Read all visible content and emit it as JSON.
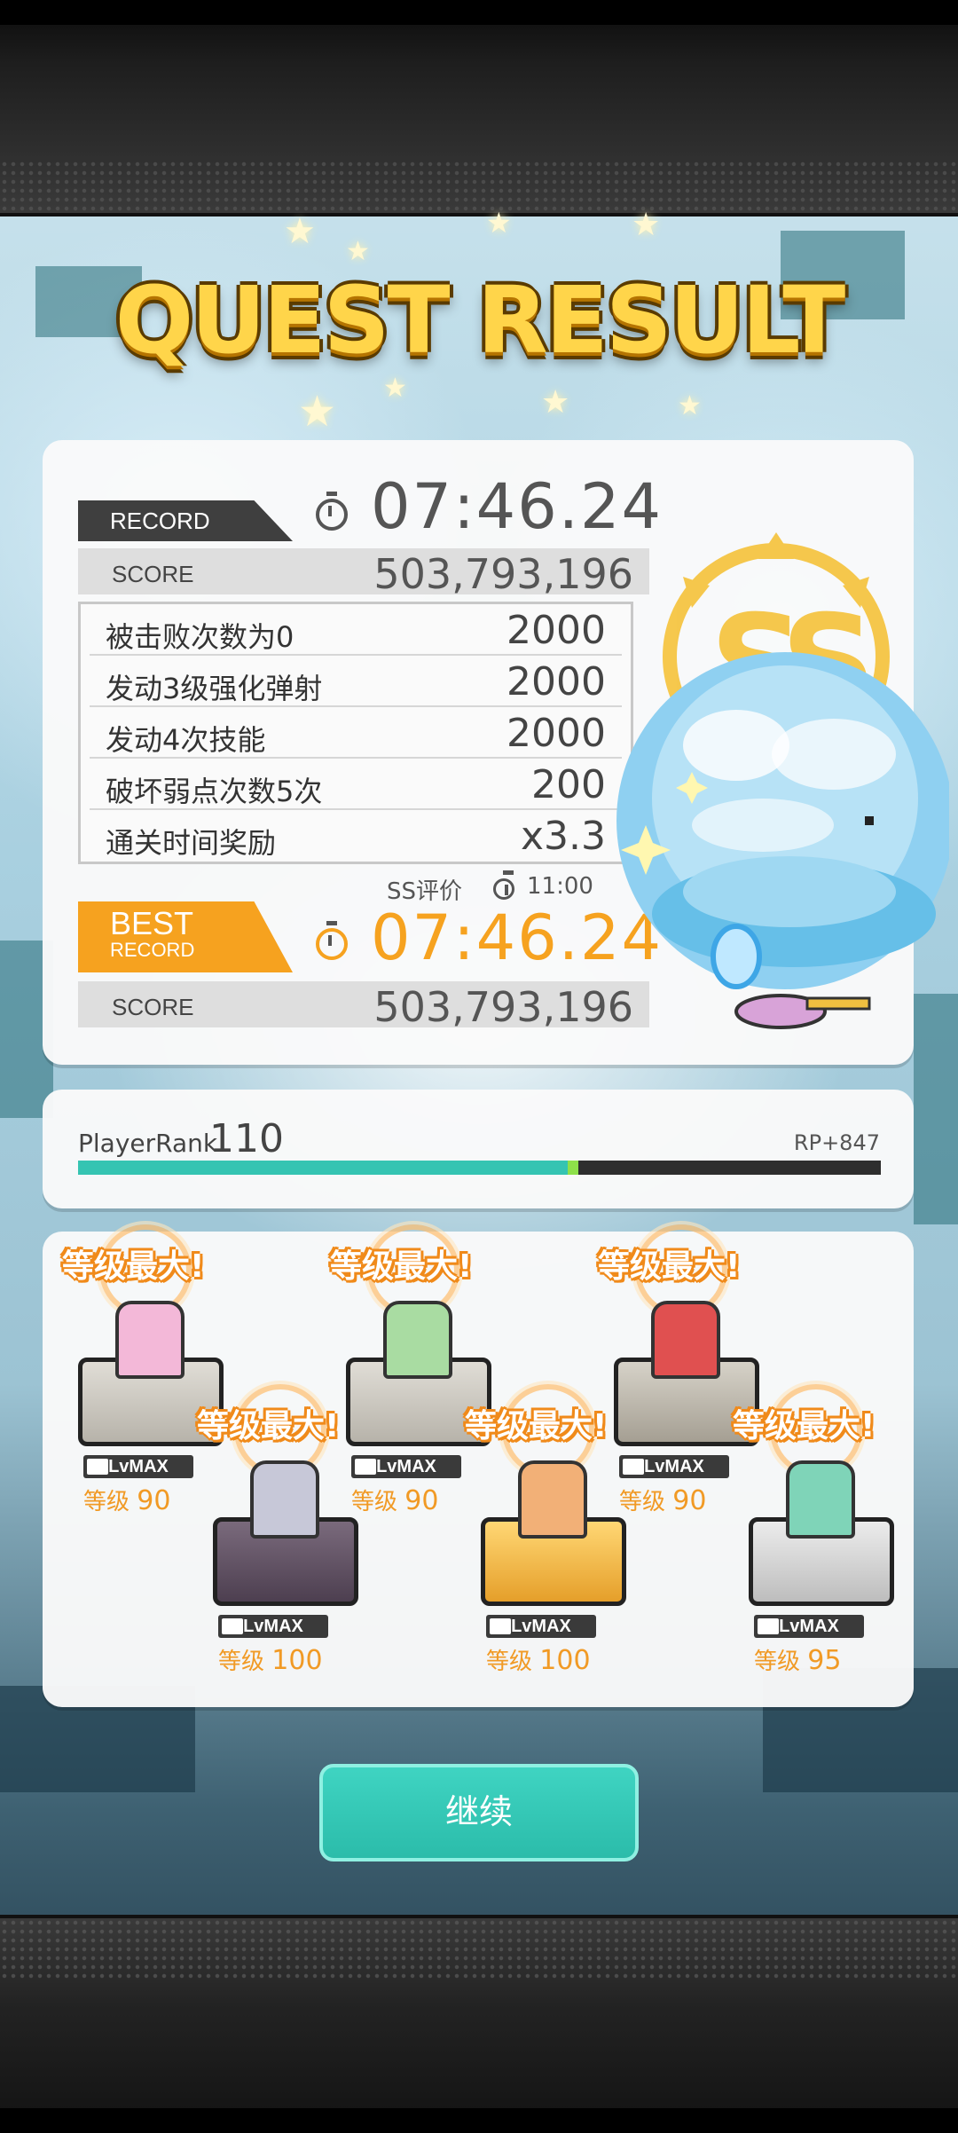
{
  "title": "QUEST RESULT",
  "record": {
    "tag": "RECORD",
    "time": "07:46.24",
    "score_label": "SCORE",
    "score": "503,793,196"
  },
  "bonuses": [
    {
      "name": "被击败次数为0",
      "value": "2000"
    },
    {
      "name": "发动3级强化弹射",
      "value": "2000"
    },
    {
      "name": "发动4次技能",
      "value": "2000"
    },
    {
      "name": "破坏弱点次数5次",
      "value": "200"
    },
    {
      "name": "通关时间奖励",
      "value": "x3.3"
    }
  ],
  "ss_criteria": {
    "label": "SS评价",
    "time": "11:00"
  },
  "best": {
    "tag_main": "BEST",
    "tag_sub": "RECORD",
    "time": "07:46.24",
    "score_label": "SCORE",
    "score": "503,793,196"
  },
  "player": {
    "rank_label": "PlayerRank",
    "rank": "110",
    "rp": "RP+847",
    "progress": 0.61
  },
  "characters": [
    {
      "badge": "等级最大!",
      "lvmax": "LvMAX",
      "level_prefix": "等级",
      "level": "90"
    },
    {
      "badge": "等级最大!",
      "lvmax": "LvMAX",
      "level_prefix": "等级",
      "level": "100"
    },
    {
      "badge": "等级最大!",
      "lvmax": "LvMAX",
      "level_prefix": "等级",
      "level": "90"
    },
    {
      "badge": "等级最大!",
      "lvmax": "LvMAX",
      "level_prefix": "等级",
      "level": "100"
    },
    {
      "badge": "等级最大!",
      "lvmax": "LvMAX",
      "level_prefix": "等级",
      "level": "90"
    },
    {
      "badge": "等级最大!",
      "lvmax": "LvMAX",
      "level_prefix": "等级",
      "level": "95"
    }
  ],
  "continue_label": "继续",
  "colors": {
    "accent_teal": "#35c4b2",
    "best_orange": "#f6a21f",
    "title_gold": "#ffd54a"
  }
}
